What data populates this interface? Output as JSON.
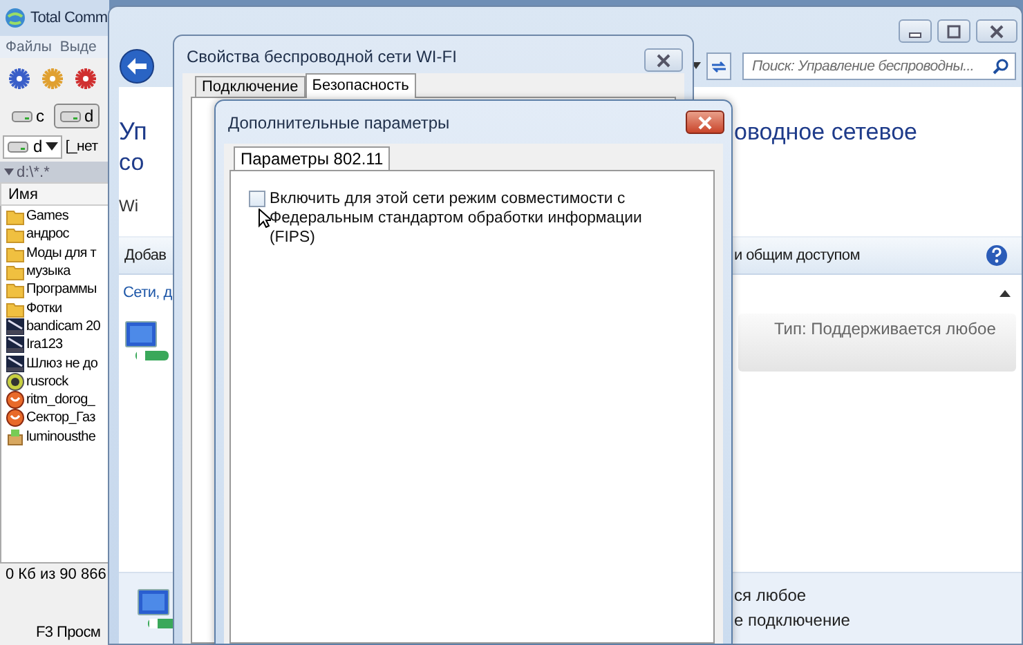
{
  "total_commander": {
    "title": "Total Comm",
    "menu": [
      "Файлы",
      "Выде"
    ],
    "drives": [
      {
        "label": "c",
        "selected": false
      },
      {
        "label": "d",
        "selected": true
      }
    ],
    "drive_combo": {
      "value": "d"
    },
    "drive_info": "[_нет",
    "path": "d:\\*.*",
    "column": "Имя",
    "files": [
      {
        "name": "Games",
        "kind": "folder"
      },
      {
        "name": "андрос",
        "kind": "folder"
      },
      {
        "name": "Моды для т",
        "kind": "folder"
      },
      {
        "name": "музыка",
        "kind": "folder"
      },
      {
        "name": "Программы",
        "kind": "folder"
      },
      {
        "name": "Фотки",
        "kind": "folder"
      },
      {
        "name": "bandicam 20",
        "kind": "video"
      },
      {
        "name": "Ira123",
        "kind": "video"
      },
      {
        "name": "Шлюз не до",
        "kind": "video"
      },
      {
        "name": "rusrock",
        "kind": "player"
      },
      {
        "name": "ritm_dorog_",
        "kind": "media"
      },
      {
        "name": "Сектор_Газ",
        "kind": "media"
      },
      {
        "name": "luminousthe",
        "kind": "package"
      }
    ],
    "status": "0 Кб из 90 866",
    "function_key": "F3 Просм"
  },
  "explorer": {
    "search": {
      "placeholder": "Поиск: Управление беспроводны..."
    },
    "heading_left": "Уп",
    "heading_right": "оводное сетевое",
    "subheading_left": "со",
    "info_left": "Wi",
    "toolbar_left": "Добав",
    "toolbar_right": "и общим доступом",
    "section_title": "Сети, д",
    "network_type": "Тип: Поддерживается любое",
    "bottom_lines": [
      "ся любое",
      "е подключение"
    ]
  },
  "properties_window": {
    "title": "Свойства беспроводной сети WI-FI",
    "tabs": [
      {
        "label": "Подключение",
        "selected": false
      },
      {
        "label": "Безопасность",
        "selected": true
      }
    ]
  },
  "advanced_dialog": {
    "title": "Дополнительные параметры",
    "tabs": [
      {
        "label": "Параметры 802.11",
        "selected": true
      }
    ],
    "fips_checkbox": {
      "label": "Включить для этой сети режим совместимости с Федеральным стандартом обработки информации (FIPS)",
      "checked": false
    }
  }
}
